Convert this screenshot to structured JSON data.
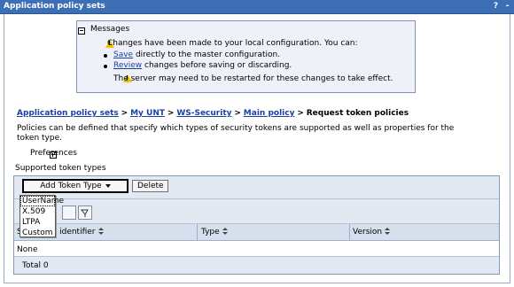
{
  "window": {
    "title": "Application policy sets",
    "help_icon": "?",
    "close_icon": "-"
  },
  "messages": {
    "header": "Messages",
    "line1": "Changes have been made to your local configuration. You can:",
    "save_link": "Save",
    "save_text": "directly to the master configuration.",
    "review_link": "Review",
    "review_text": "changes before saving or discarding.",
    "warning": "The server may need to be restarted for these changes to take effect."
  },
  "breadcrumb": {
    "items": [
      "Application policy sets",
      "My UNT",
      "WS-Security",
      "Main policy"
    ],
    "separator": ">",
    "current": "Request token policies"
  },
  "description": {
    "line1": "Policies can be defined that specify which types of security tokens are supported as well as properties for the",
    "line2": "token type."
  },
  "preferences_label": "Preferences",
  "section_title": "Supported token types",
  "toolbar": {
    "add_label": "Add Token Type",
    "delete_label": "Delete"
  },
  "dropdown": {
    "options": [
      "UserName",
      "X.509",
      "LTPA",
      "Custom"
    ]
  },
  "table": {
    "columns": [
      "Select",
      "Token identifier",
      "Type",
      "Version"
    ],
    "col_select_visible": "S",
    "col_token_visible": "en identifier",
    "empty_text": "None",
    "total_text": "Total 0"
  },
  "colors": {
    "titlebar": "#3d6fb6",
    "message_bg": "#eef2f8",
    "link": "#1c3fa3",
    "table_bg": "#e2e9f3",
    "warning": "#f2c200"
  }
}
